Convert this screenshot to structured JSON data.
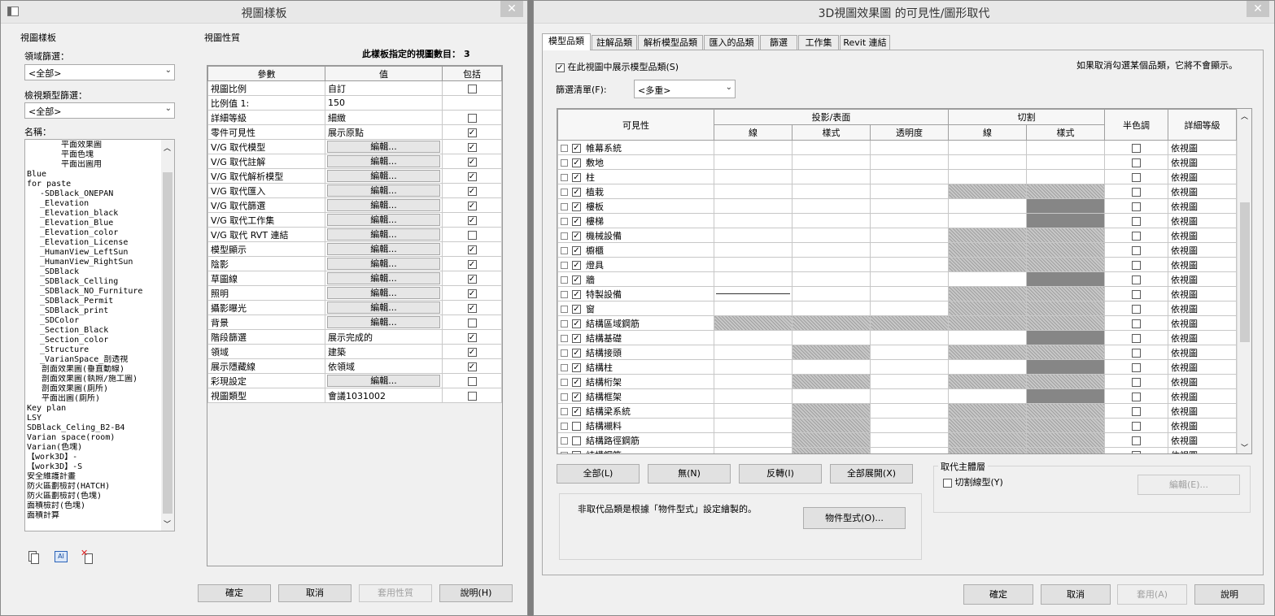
{
  "left_dialog": {
    "title": "視圖樣板",
    "close_glyph": "✕",
    "left_group_title": "視圖樣板",
    "discipline_filter_label": "領域篩選：",
    "discipline_filter_value": "<全部>",
    "view_type_filter_label": "檢視類型篩選：",
    "view_type_filter_value": "<全部>",
    "names_label": "名稱：",
    "names": [
      "平面效果圖",
      "平面色塊",
      "平面出圖用",
      "Blue",
      "for paste",
      "-SDBlack_ONEPAN",
      "_Elevation",
      "_Elevation_black",
      "_Elevation_Blue",
      "_Elevation_color",
      "_Elevation_License",
      "_HumanView_LeftSun",
      "_HumanView_RightSun",
      "_SDBlack",
      "_SDBlack_Celling",
      "_SDBlack_NO_Furniture",
      "_SDBlack_Permit",
      "_SDBlack_print",
      "_SDColor",
      "_Section_Black",
      "_Section_color",
      "_Structure",
      "_VarianSpace_剖透視",
      "剖面效果圖(垂直動線)",
      "剖面效果圖(執照/施工圖)",
      "剖面效果圖(廁所)",
      "平面出圖(廁所)",
      "Key plan",
      "LSY",
      "SDBlack_Celing_B2-B4",
      "Varian space(room)",
      "Varian(色塊)",
      "【work3D】-",
      "【work3D】-S",
      "安全維護計畫",
      "防火區劃檢討(HATCH)",
      "防火區劃檢討(色塊)",
      "面積檢討(色塊)",
      "面積計算"
    ],
    "props_group_title": "視圖性質",
    "count_label": "此樣板指定的視圖數目：",
    "count_value": "3",
    "col_param": "參數",
    "col_value": "值",
    "col_include": "包括",
    "props": [
      {
        "p": "視圖比例",
        "v": "自訂",
        "btn": false,
        "c": false
      },
      {
        "p": "比例值 1:",
        "v": "150",
        "btn": false,
        "c": null
      },
      {
        "p": "詳細等級",
        "v": "細緻",
        "btn": false,
        "c": false
      },
      {
        "p": "零件可見性",
        "v": "展示原點",
        "btn": false,
        "c": true
      },
      {
        "p": "V/G 取代模型",
        "v": "編輯...",
        "btn": true,
        "c": true
      },
      {
        "p": "V/G 取代註解",
        "v": "編輯...",
        "btn": true,
        "c": true
      },
      {
        "p": "V/G 取代解析模型",
        "v": "編輯...",
        "btn": true,
        "c": true
      },
      {
        "p": "V/G 取代匯入",
        "v": "編輯...",
        "btn": true,
        "c": true
      },
      {
        "p": "V/G 取代篩選",
        "v": "編輯...",
        "btn": true,
        "c": true
      },
      {
        "p": "V/G 取代工作集",
        "v": "編輯...",
        "btn": true,
        "c": true
      },
      {
        "p": "V/G 取代 RVT 連結",
        "v": "編輯...",
        "btn": true,
        "c": false
      },
      {
        "p": "模型顯示",
        "v": "編輯...",
        "btn": true,
        "c": true
      },
      {
        "p": "陰影",
        "v": "編輯...",
        "btn": true,
        "c": true
      },
      {
        "p": "草圖線",
        "v": "編輯...",
        "btn": true,
        "c": true
      },
      {
        "p": "照明",
        "v": "編輯...",
        "btn": true,
        "c": true
      },
      {
        "p": "攝影曝光",
        "v": "編輯...",
        "btn": true,
        "c": true
      },
      {
        "p": "背景",
        "v": "編輯...",
        "btn": true,
        "c": false
      },
      {
        "p": "階段篩選",
        "v": "展示完成的",
        "btn": false,
        "c": true
      },
      {
        "p": "領域",
        "v": "建築",
        "btn": false,
        "c": true
      },
      {
        "p": "展示隱藏線",
        "v": "依領域",
        "btn": false,
        "c": true
      },
      {
        "p": "彩現設定",
        "v": "編輯...",
        "btn": true,
        "c": false
      },
      {
        "p": "視圖類型",
        "v": "會議1031002",
        "btn": false,
        "c": false
      }
    ],
    "ok": "確定",
    "cancel": "取消",
    "apply_props": "套用性質",
    "help": "說明(H)"
  },
  "right_dialog": {
    "title": "3D視圖效果圖 的可見性/圖形取代",
    "close_glyph": "✕",
    "tabs": [
      "模型品類",
      "註解品類",
      "解析模型品類",
      "匯入的品類",
      "篩選",
      "工作集",
      "Revit 連結"
    ],
    "show_categories_label": "在此視圖中展示模型品類(S)",
    "hint": "如果取消勾選某個品類，它將不會顯示。",
    "filter_list_label": "篩選清單(F):",
    "filter_list_value": "<多重>",
    "col_visibility": "可見性",
    "col_projection": "投影/表面",
    "col_cut": "切割",
    "col_halftone": "半色調",
    "col_detail": "詳細等級",
    "col_lines": "線",
    "col_patterns": "樣式",
    "col_transparency": "透明度",
    "col_cut_lines": "線",
    "col_cut_patterns": "樣式",
    "rows": [
      {
        "n": "帷幕系統",
        "c": true,
        "p": "",
        "cut": "",
        "d": "依視圖"
      },
      {
        "n": "敷地",
        "c": true,
        "p": "",
        "cut": "",
        "d": "依視圖"
      },
      {
        "n": "柱",
        "c": true,
        "p": "",
        "cut": "",
        "d": "依視圖"
      },
      {
        "n": "植栽",
        "c": true,
        "p": "",
        "cut": "hh",
        "d": "依視圖"
      },
      {
        "n": "樓板",
        "c": true,
        "p": "",
        "cut": "hd",
        "d": "依視圖"
      },
      {
        "n": "樓梯",
        "c": true,
        "p": "",
        "cut": "hd",
        "d": "依視圖"
      },
      {
        "n": "機械設備",
        "c": true,
        "p": "",
        "cut": "hh",
        "d": "依視圖"
      },
      {
        "n": "櫥櫃",
        "c": true,
        "p": "",
        "cut": "hh",
        "d": "依視圖"
      },
      {
        "n": "燈具",
        "c": true,
        "p": "",
        "cut": "hh",
        "d": "依視圖"
      },
      {
        "n": "牆",
        "c": true,
        "p": "",
        "cut": "hd",
        "d": "依視圖"
      },
      {
        "n": "特製設備",
        "c": true,
        "p": "line",
        "cut": "hh",
        "d": "依視圖"
      },
      {
        "n": "窗",
        "c": true,
        "p": "",
        "cut": "hh",
        "d": "依視圖"
      },
      {
        "n": "結構區域鋼筋",
        "c": true,
        "p": "hhh",
        "cut": "hh",
        "d": "依視圖"
      },
      {
        "n": "結構基礎",
        "c": true,
        "p": "",
        "cut": "hd",
        "d": "依視圖"
      },
      {
        "n": "結構接頭",
        "c": true,
        "p": "h",
        "cut": "hh",
        "d": "依視圖"
      },
      {
        "n": "結構柱",
        "c": true,
        "p": "",
        "cut": "hd",
        "d": "依視圖"
      },
      {
        "n": "結構桁架",
        "c": true,
        "p": "h",
        "cut": "hh",
        "d": "依視圖"
      },
      {
        "n": "結構框架",
        "c": true,
        "p": "",
        "cut": "hd",
        "d": "依視圖"
      },
      {
        "n": "結構梁系統",
        "c": true,
        "p": "h",
        "cut": "hh",
        "d": "依視圖"
      },
      {
        "n": "結構襯料",
        "c": false,
        "p": "h",
        "cut": "hh",
        "d": "依視圖"
      },
      {
        "n": "結構路徑鋼筋",
        "c": false,
        "p": "h",
        "cut": "hh",
        "d": "依視圖"
      },
      {
        "n": "結構鋼筋",
        "c": false,
        "p": "h",
        "cut": "hh",
        "d": "依視圖"
      }
    ],
    "btn_all": "全部(L)",
    "btn_none": "無(N)",
    "btn_invert": "反轉(I)",
    "btn_expand": "全部展開(X)",
    "override_host_title": "取代主體層",
    "cut_line_styles": "切割線型(Y)",
    "edit_btn": "編輯(E)...",
    "note": "非取代品類是根據「物件型式」設定繪製的。",
    "object_styles_btn": "物件型式(O)...",
    "ok": "確定",
    "cancel": "取消",
    "apply": "套用(A)",
    "help": "說明"
  }
}
